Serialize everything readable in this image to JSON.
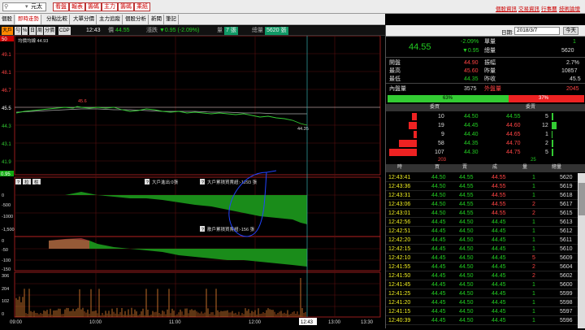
{
  "topbar": {
    "symbol": "元太",
    "buttons": [
      "看盤",
      "報表",
      "籌碼",
      "主力",
      "籌碼",
      "乘紙"
    ],
    "links": [
      "個股資訊",
      "交易資訊",
      "行事曆",
      "技術論壇"
    ]
  },
  "tabs": [
    "個股",
    "即時走勢",
    "分點比較",
    "大單分價",
    "主力追蹤",
    "個股分析",
    "新聞",
    "筆記"
  ],
  "center_title": "盤紅色區塊為連續區間",
  "infobar": {
    "buttons": [
      "大戶",
      "勻",
      "%",
      "日",
      "周",
      "分價",
      "CDP"
    ],
    "time": "12:43",
    "price_label": "價",
    "price": "44.55",
    "change_label": "漲跌",
    "change": "▼0.95 (-2.09%)",
    "vol_label": "量",
    "vol": "7 張",
    "total_vol_label": "總量",
    "total_vol": "5620 張"
  },
  "chart": {
    "avg_label": "均價均線 44.93",
    "mark_high": "45.6",
    "last_label": "44.35",
    "price_axis": [
      "50",
      "49.1",
      "48.1",
      "46.7",
      "45.5",
      "44.3",
      "43.1",
      "41.9",
      "0.95"
    ],
    "mid_buttons": [
      "?",
      "拉",
      "柱"
    ],
    "panel2_label": "大戶進出:0張",
    "panel2_label2": "大戶累積買賣超:-1293 張",
    "panel2_axis": [
      "0",
      "-500",
      "-1000",
      "-1,500"
    ],
    "panel3_label": "散戶累積買賣超:-156 張",
    "panel3_axis": [
      "0",
      "-50",
      "-100",
      "-150"
    ],
    "panel4_axis": [
      "306",
      "204",
      "102",
      "0"
    ],
    "time_axis": [
      "09:00",
      "10:00",
      "11:00",
      "12:00",
      "12:43",
      "13:00",
      "13:30"
    ]
  },
  "right_panel": {
    "date_label": "日期:",
    "date_value": "2018/3/7",
    "today_btn": "今天",
    "price": "44.55",
    "change_pct": "-2.09%",
    "change": "▼0.95",
    "single_label": "單量",
    "single_value": "1",
    "total_label": "總量",
    "total_value": "5620",
    "stats": [
      {
        "l": "開盤",
        "v": "44.90",
        "l2": "振幅",
        "v2": "2.7%"
      },
      {
        "l": "最高",
        "v": "45.60",
        "l2": "昨量",
        "v2": "10857"
      },
      {
        "l": "最低",
        "v": "44.35",
        "l2": "昨收",
        "v2": "45.5"
      }
    ],
    "inner_label": "內盤量",
    "inner_value": "3575",
    "outer_label": "外盤量",
    "outer_value": "2045",
    "inner_pct": "63%",
    "outer_pct": "37%",
    "book_header": [
      "委買",
      "委賣"
    ],
    "book": [
      {
        "bq": "10",
        "bp": "44.50",
        "ap": "44.55",
        "aq": "5"
      },
      {
        "bq": "19",
        "bp": "44.45",
        "ap": "44.60",
        "aq": "12"
      },
      {
        "bq": "9",
        "bp": "44.40",
        "ap": "44.65",
        "aq": "1"
      },
      {
        "bq": "58",
        "bp": "44.35",
        "ap": "44.70",
        "aq": "2"
      },
      {
        "bq": "107",
        "bp": "44.30",
        "ap": "44.75",
        "aq": "5"
      }
    ],
    "book_total": [
      "203",
      "25"
    ],
    "tick_header": [
      "時",
      "買",
      "賣",
      "成",
      "量",
      "總量"
    ],
    "ticks": [
      [
        "12:43:41",
        "44.50",
        "44.55",
        "44.55",
        "1",
        "5620"
      ],
      [
        "12:43:36",
        "44.50",
        "44.55",
        "44.55",
        "1",
        "5619"
      ],
      [
        "12:43:31",
        "44.50",
        "44.55",
        "44.55",
        "1",
        "5618"
      ],
      [
        "12:43:06",
        "44.50",
        "44.55",
        "44.55",
        "2",
        "5617"
      ],
      [
        "12:43:01",
        "44.50",
        "44.55",
        "44.55",
        "2",
        "5615"
      ],
      [
        "12:42:56",
        "44.45",
        "44.50",
        "44.45",
        "1",
        "5613"
      ],
      [
        "12:42:51",
        "44.45",
        "44.50",
        "44.45",
        "1",
        "5612"
      ],
      [
        "12:42:20",
        "44.45",
        "44.50",
        "44.45",
        "1",
        "5611"
      ],
      [
        "12:42:15",
        "44.45",
        "44.50",
        "44.45",
        "1",
        "5610"
      ],
      [
        "12:42:10",
        "44.45",
        "44.50",
        "44.45",
        "5",
        "5609"
      ],
      [
        "12:41:55",
        "44.45",
        "44.50",
        "44.45",
        "2",
        "5604"
      ],
      [
        "12:41:50",
        "44.45",
        "44.50",
        "44.45",
        "2",
        "5602"
      ],
      [
        "12:41:45",
        "44.45",
        "44.50",
        "44.45",
        "1",
        "5600"
      ],
      [
        "12:41:25",
        "44.45",
        "44.50",
        "44.45",
        "1",
        "5599"
      ],
      [
        "12:41:20",
        "44.45",
        "44.50",
        "44.45",
        "1",
        "5598"
      ],
      [
        "12:41:15",
        "44.45",
        "44.50",
        "44.45",
        "1",
        "5597"
      ],
      [
        "12:40:39",
        "44.45",
        "44.50",
        "44.45",
        "1",
        "5596"
      ]
    ]
  }
}
